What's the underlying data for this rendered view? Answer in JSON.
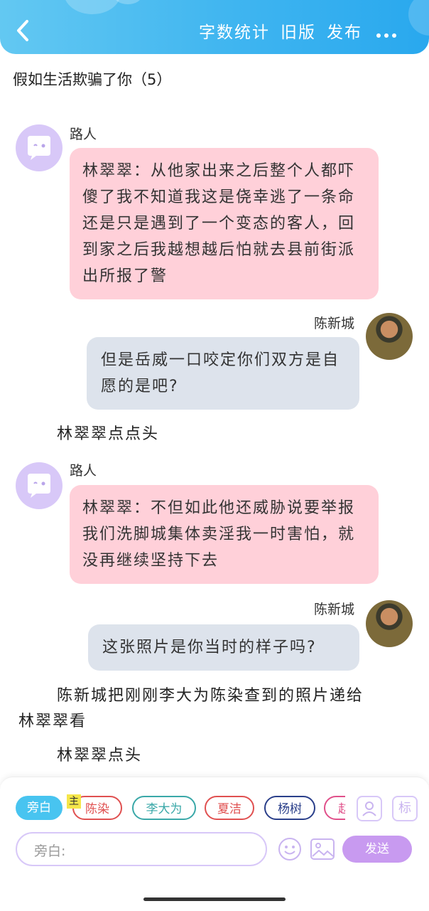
{
  "header": {
    "word_count_label": "字数统计",
    "old_version_label": "旧版",
    "publish_label": "发布"
  },
  "chapter_title": "假如生活欺骗了你（5）",
  "messages": [
    {
      "speaker": "路人",
      "text": "林翠翠：从他家出来之后整个人都吓傻了我不知道我这是侥幸逃了一条命还是只是遇到了一个变态的客人，回到家之后我越想越后怕就去县前街派出所报了警"
    },
    {
      "speaker": "陈新城",
      "text": "但是岳威一口咬定你们双方是自愿的是吧?"
    },
    {
      "narration": "林翠翠点点头"
    },
    {
      "speaker": "路人",
      "text": "林翠翠：不但如此他还威胁说要举报我们洗脚城集体卖淫我一时害怕，就没再继续坚持下去"
    },
    {
      "speaker": "陈新城",
      "text": "这张照片是你当时的样子吗?"
    },
    {
      "narration_line1": "陈新城把刚刚李大为陈染查到的照片递给",
      "narration_line2": "林翠翠看"
    },
    {
      "narration": "林翠翠点头"
    }
  ],
  "role_chips": [
    {
      "label": "旁白",
      "selected": true
    },
    {
      "label": "陈染",
      "badge": "主",
      "color": "#e05050"
    },
    {
      "label": "李大为",
      "color": "#3aa8a8"
    },
    {
      "label": "夏洁",
      "color": "#e05050"
    },
    {
      "label": "杨树",
      "color": "#2a3f8a"
    },
    {
      "label": "赵",
      "color": "#e0508a"
    }
  ],
  "input": {
    "placeholder": "旁白:"
  },
  "send_label": "发送",
  "tool_labels": {
    "style": "标"
  },
  "colors": {
    "header": "#3fb5f0",
    "pink_bubble": "#ffd0d9",
    "gray_bubble": "#dde3ec",
    "accent": "#c89af0"
  }
}
